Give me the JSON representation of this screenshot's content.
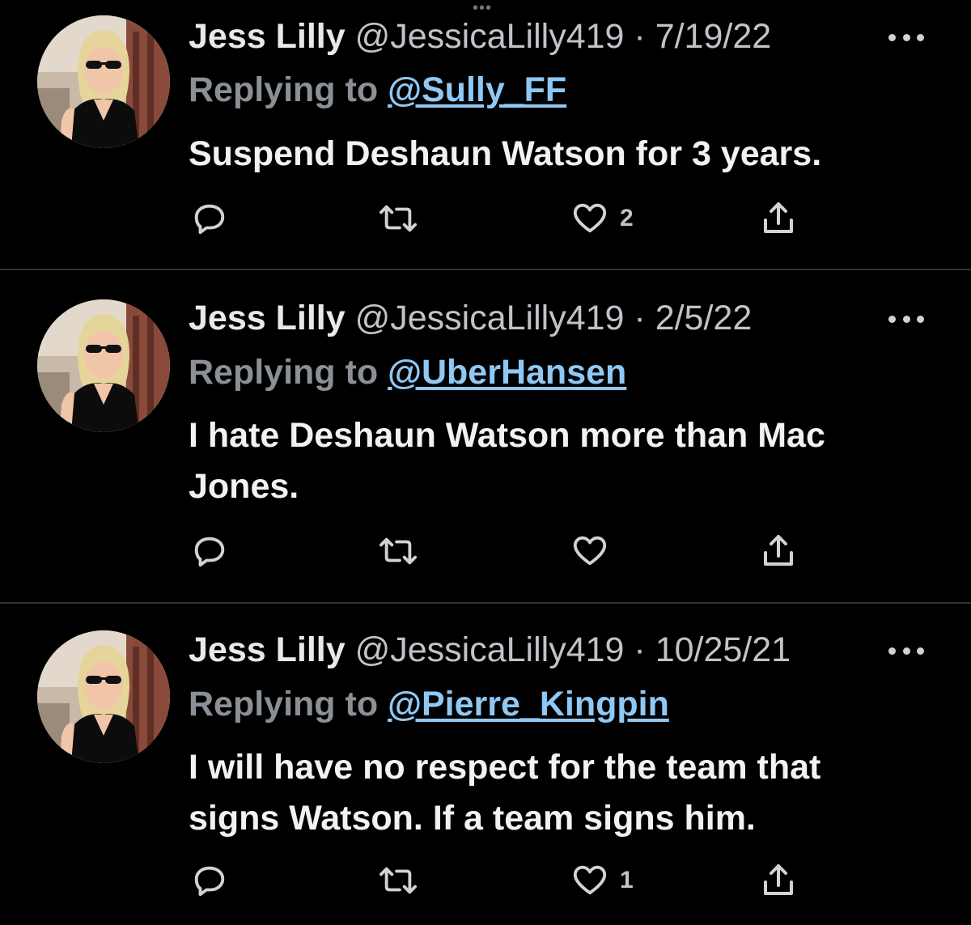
{
  "tweets": [
    {
      "name": "Jess Lilly",
      "handle": "@JessicaLilly419",
      "separator": "·",
      "date": "7/19/22",
      "reply_prefix": "Replying to",
      "reply_target": "@Sully_FF",
      "text": "Suspend Deshaun Watson for 3 years.",
      "reply_count": "",
      "retweet_count": "",
      "like_count": "2"
    },
    {
      "name": "Jess Lilly",
      "handle": "@JessicaLilly419",
      "separator": "·",
      "date": "2/5/22",
      "reply_prefix": "Replying to",
      "reply_target": "@UberHansen",
      "text": "I hate Deshaun Watson more than Mac Jones.",
      "reply_count": "",
      "retweet_count": "",
      "like_count": ""
    },
    {
      "name": "Jess Lilly",
      "handle": "@JessicaLilly419",
      "separator": "·",
      "date": "10/25/21",
      "reply_prefix": "Replying to",
      "reply_target": "@Pierre_Kingpin",
      "text": "I will have no respect for the team that signs Watson. If a team signs him.",
      "reply_count": "",
      "retweet_count": "",
      "like_count": "1"
    }
  ],
  "icons": {
    "more": "more-horizontal-icon",
    "reply": "reply-bubble-icon",
    "retweet": "retweet-icon",
    "like": "heart-icon",
    "share": "share-icon"
  },
  "colors": {
    "background": "#000000",
    "text": "#e7e9ea",
    "muted": "#8b9096",
    "link": "#8fc8f4",
    "divider": "#2f3336"
  }
}
